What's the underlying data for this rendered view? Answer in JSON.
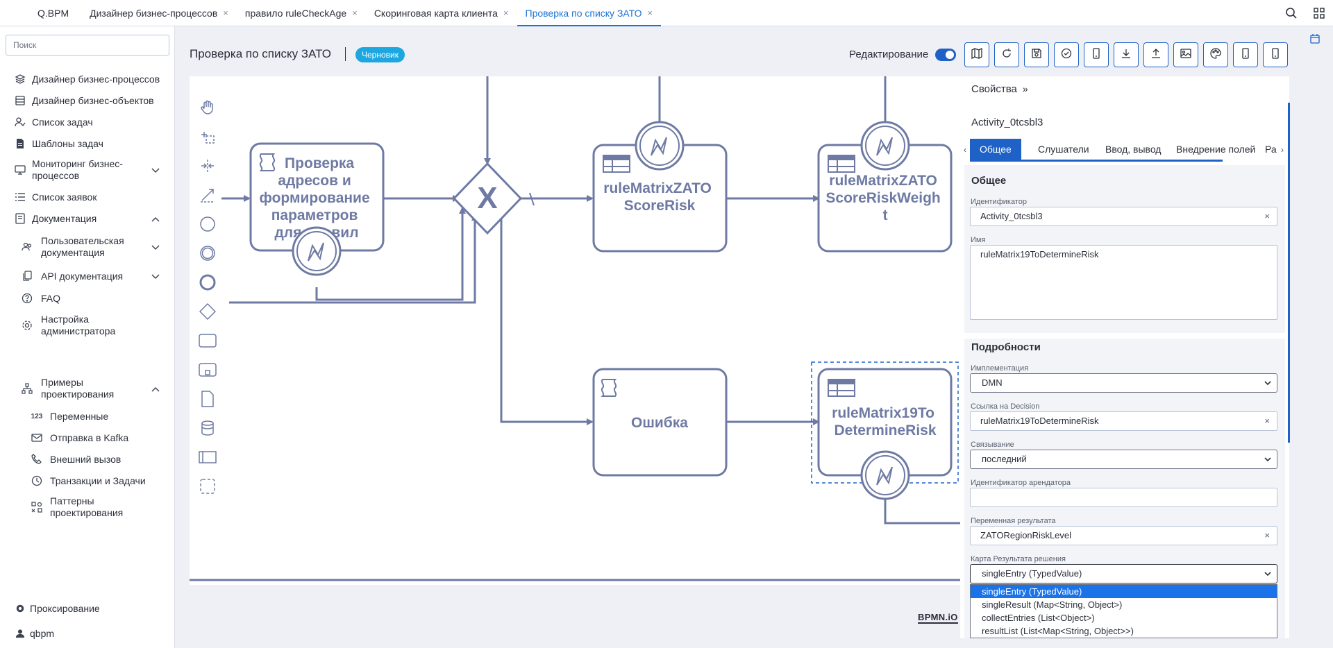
{
  "tabs": [
    {
      "label": "Q.BPM",
      "closable": false
    },
    {
      "label": "Дизайнер бизнес-процессов",
      "closable": true
    },
    {
      "label": "правило ruleCheckAge",
      "closable": true
    },
    {
      "label": "Скоринговая карта клиента",
      "closable": true
    },
    {
      "label": "Проверка по списку ЗАТО",
      "closable": true,
      "active": true
    }
  ],
  "tab_close": "×",
  "sidebar": {
    "search_placeholder": "Поиск",
    "items": [
      {
        "label": "Дизайнер бизнес-процессов",
        "icon": "stack-icon"
      },
      {
        "label": "Дизайнер бизнес-объектов",
        "icon": "database-icon"
      },
      {
        "label": "Список задач",
        "icon": "user-check-icon"
      },
      {
        "label": "Шаблоны задач",
        "icon": "document-icon"
      },
      {
        "label": "Мониторинг бизнес-процессов",
        "icon": "monitor-icon",
        "chevron": "down"
      },
      {
        "label": "Список заявок",
        "icon": "list-icon"
      },
      {
        "label": "Документация",
        "icon": "book-icon",
        "chevron": "up"
      },
      {
        "label": "Пользовательская документация",
        "icon": "users-icon",
        "chevron": "down"
      },
      {
        "label": "API документация",
        "icon": "copy-icon",
        "chevron": "down"
      },
      {
        "label": "FAQ",
        "icon": "help-icon"
      },
      {
        "label": "Настройка администратора",
        "icon": "gear-icon"
      },
      {
        "label": "Примеры проектирования",
        "icon": "hierarchy-icon",
        "chevron": "up"
      },
      {
        "label": "Переменные",
        "icon": "numbers-icon"
      },
      {
        "label": "Отправка в Kafka",
        "icon": "mail-icon"
      },
      {
        "label": "Внешний вызов",
        "icon": "phone-icon"
      },
      {
        "label": "Транзакции и Задачи",
        "icon": "clock-icon"
      },
      {
        "label": "Паттерны проектирования",
        "icon": "patterns-icon"
      }
    ],
    "footer": [
      {
        "label": "Проксирование",
        "icon": "gear-icon"
      },
      {
        "label": "qbpm",
        "icon": "user-icon"
      }
    ]
  },
  "header": {
    "title": "Проверка по списку ЗАТО",
    "status_badge": "Черновик",
    "edit_label": "Редактирование",
    "edit_enabled": true
  },
  "toolbar_icons": [
    "map-icon",
    "refresh-icon",
    "save-icon",
    "check-circle-icon",
    "mobile-icon",
    "download-icon",
    "upload-icon",
    "image-icon",
    "palette-icon",
    "mobile-icon",
    "mobile-icon"
  ],
  "diagram": {
    "task_address": "Проверка адресов и формирование параметров для правил",
    "task_score_risk": "ruleMatrixZATOScoreRisk",
    "task_score_risk_weight": "ruleMatrixZATOScoreRiskWeight",
    "task_error": "Ошибка",
    "task_determine_risk": "ruleMatrix19ToDetermineRisk",
    "gateway": "X",
    "logo": "BPMN.iO"
  },
  "props": {
    "heading": "Свойства",
    "collapse_glyph": "»",
    "element_id": "Activity_0tcsbl3",
    "tabs": [
      "Общее",
      "Слушатели",
      "Ввод, вывод",
      "Внедрение полей",
      "Ра"
    ],
    "active_tab": "Общее",
    "general": {
      "title": "Общее",
      "id_label": "Идентификатор",
      "id_value": "Activity_0tcsbl3",
      "name_label": "Имя",
      "name_value": "ruleMatrix19ToDetermineRisk"
    },
    "details": {
      "title": "Подробности",
      "impl_label": "Имплементация",
      "impl_value": "DMN",
      "decision_label": "Ссылка на Decision",
      "decision_value": "ruleMatrix19ToDetermineRisk",
      "binding_label": "Связывание",
      "binding_value": "последний",
      "tenant_label": "Идентификатор арендатора",
      "tenant_value": "",
      "result_var_label": "Переменная результата",
      "result_var_value": "ZATORegionRiskLevel",
      "map_label": "Карта Результата решения",
      "map_value": "singleEntry (TypedValue)",
      "map_options": [
        "singleEntry (TypedValue)",
        "singleResult (Map<String, Object>)",
        "collectEntries (List<Object>)",
        "resultList (List<Map<String, Object>>)"
      ]
    },
    "clear_glyph": "×"
  },
  "colors": {
    "accent": "#1e62c8",
    "diagram": "#6e7aa3",
    "badge": "#1ca7e0",
    "selection": "#1a73e8"
  }
}
